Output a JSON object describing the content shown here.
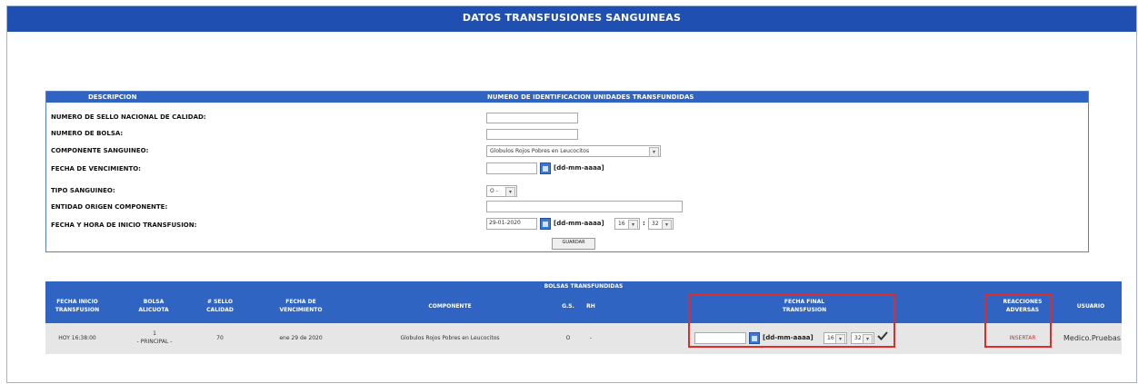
{
  "page": {
    "title": "DATOS TRANSFUSIONES SANGUINEAS"
  },
  "form": {
    "header_left": "DESCRIPCION",
    "header_right": "NUMERO DE IDENTIFICACION UNIDADES TRANSFUNDIDAS",
    "labels": {
      "sello": "NUMERO DE SELLO NACIONAL DE CALIDAD:",
      "bolsa": "NUMERO DE BOLSA:",
      "componente": "COMPONENTE SANGUINEO:",
      "vencimiento": "FECHA DE VENCIMIENTO:",
      "tipo": "TIPO SANGUINEO:",
      "entidad": "ENTIDAD ORIGEN COMPONENTE:",
      "inicio": "FECHA Y HORA DE INICIO TRANSFUSION:"
    },
    "values": {
      "sello": "",
      "bolsa": "",
      "componente": "Globulos Rojos Pobres en Leucocitos",
      "vencimiento": "",
      "tipo": "O -",
      "entidad": "",
      "inicio_fecha": "29-01-2020",
      "inicio_hora": "16",
      "inicio_min": "32"
    },
    "date_hint": "[dd-mm-aaaa]",
    "time_sep": ":",
    "save_label": "GUARDAR"
  },
  "table": {
    "title": "BOLSAS TRANSFUNDIDAS",
    "headers": {
      "fecha_inicio": "FECHA INICIO TRANSFUSION",
      "bolsa": "BOLSA ALICUOTA",
      "sello": "# SELLO CALIDAD",
      "vencimiento": "FECHA DE VENCIMIENTO",
      "componente": "COMPONENTE",
      "gs": "G.S.",
      "rh": "RH",
      "fecha_final": "FECHA FINAL TRANSFUSION",
      "reacciones": "REACCIONES ADVERSAS",
      "usuario": "USUARIO"
    },
    "row": {
      "fecha_inicio": "HOY 16:38:00",
      "bolsa_num": "1",
      "bolsa_tipo": "- PRINCIPAL -",
      "sello": "70",
      "vencimiento": "ene 29 de 2020",
      "componente": "Globulos Rojos Pobres en Leucocitos",
      "gs": "O",
      "rh": "-",
      "fecha_final": "",
      "final_hint": "[dd-mm-aaaa]",
      "final_hora": "16",
      "final_min": "32",
      "reacciones": "INSERTAR",
      "usuario": "Medico.Pruebas"
    }
  }
}
